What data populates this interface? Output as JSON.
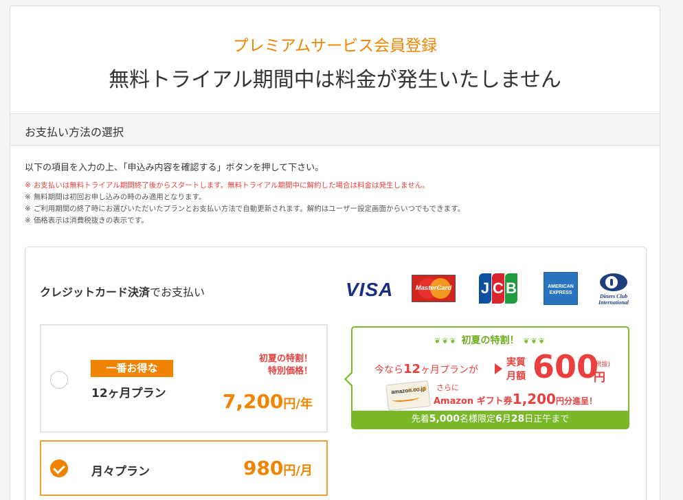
{
  "header": {
    "subtitle": "プレミアムサービス会員登録",
    "title": "無料トライアル期間中は料金が発生いたしません"
  },
  "section": {
    "title": "お支払い方法の選択"
  },
  "intro": "以下の項目を入力の上、「申込み内容を確認する」ボタンを押して下さい。",
  "notes": [
    {
      "mark": "※",
      "text": "お支払いは無料トライアル期間終了後からスタートします。無料トライアル期間中に解約した場合は料金は発生しません。",
      "color": "#e9403f"
    },
    {
      "mark": "※",
      "text": "無料期間は初回お申し込みの時のみ適用となります。"
    },
    {
      "mark": "※",
      "text": "ご利用期間の終了時にお選びいただいたプランとお支払い方法で自動更新されます。解約はユーザー設定画面からいつでもできます。"
    },
    {
      "mark": "※",
      "text": "価格表示は消費税抜きの表示です。"
    }
  ],
  "credit": {
    "title_bold": "クレジットカード決済",
    "title_rest": "でお支払い",
    "logos": {
      "visa": "VISA",
      "mastercard": "MasterCard",
      "jcb": [
        "J",
        "C",
        "B"
      ],
      "amex_line1": "AMERICAN",
      "amex_line2": "EXPRESS",
      "diners_line1": "Diners Club",
      "diners_line2": "International"
    }
  },
  "plans": {
    "yearly": {
      "badge": "一番お得な",
      "name": "12ヶ月プラン",
      "promo_line1": "初夏の特割！",
      "promo_line2": "特別価格！",
      "price": "7,200",
      "unit": "円/年",
      "selected": false
    },
    "monthly": {
      "name": "月々プラン",
      "price": "980",
      "unit": "円/月",
      "selected": true
    }
  },
  "promo": {
    "heading": "初夏の特割！",
    "now_prefix": "今なら",
    "now_months": "12",
    "now_suffix": "ヶ月プランが",
    "label_line1": "実質",
    "label_line2": "月額",
    "monthly_price": "600",
    "tax_note": "(税抜)",
    "yen": "円",
    "card_brand": "amazon.co.jp",
    "card_text": "ギフト券",
    "additionally": "さらに",
    "gift_name": "Amazon ギフト券",
    "gift_amount": "1,200",
    "gift_suffix": "円分進呈！",
    "footer_prefix": "先着",
    "footer_count": "5,000",
    "footer_mid": "名様限定",
    "footer_month": "6",
    "footer_month_unit": "月",
    "footer_day": "28",
    "footer_suffix": "日正午まで"
  },
  "colors": {
    "orange": "#f08300",
    "red": "#e9403f",
    "green": "#78b829",
    "visa_blue": "#1a2b86",
    "amex_blue": "#2a73bf"
  }
}
